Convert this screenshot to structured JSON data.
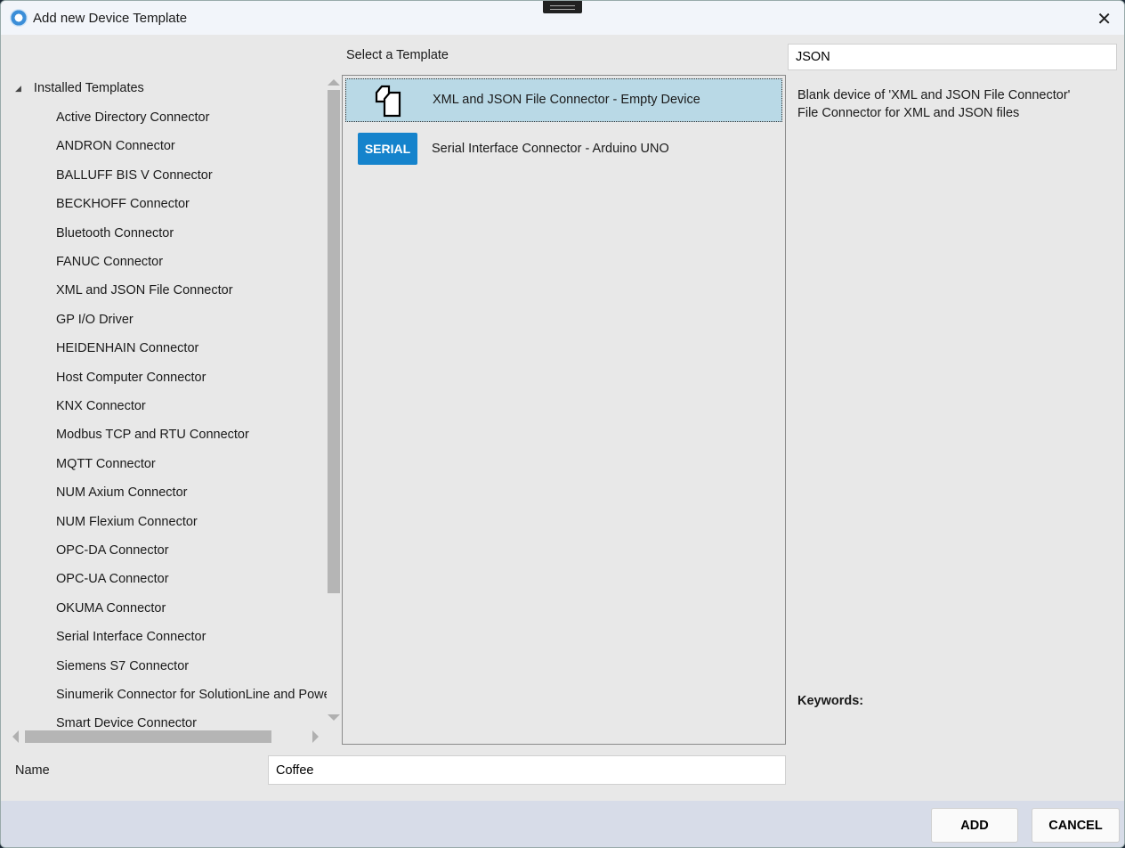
{
  "window": {
    "title": "Add new Device Template"
  },
  "tree": {
    "root_label": "Installed Templates",
    "items": [
      "Active Directory Connector",
      "ANDRON Connector",
      "BALLUFF BIS V Connector",
      "BECKHOFF Connector",
      "Bluetooth Connector",
      "FANUC Connector",
      "XML and JSON File Connector",
      "GP I/O Driver",
      "HEIDENHAIN Connector",
      "Host Computer Connector",
      "KNX Connector",
      "Modbus TCP and RTU Connector",
      "MQTT Connector",
      "NUM Axium Connector",
      "NUM Flexium Connector",
      "OPC-DA Connector",
      "OPC-UA Connector",
      "OKUMA Connector",
      "Serial Interface Connector",
      "Siemens S7 Connector",
      "Sinumerik Connector for SolutionLine and PowerLine",
      "Smart Device Connector"
    ]
  },
  "templates": {
    "heading": "Select a Template",
    "items": [
      {
        "label": "XML and JSON File Connector - Empty Device",
        "icon": "files-icon",
        "selected": true
      },
      {
        "label": "Serial Interface Connector - Arduino UNO",
        "icon": "serial-badge",
        "badge": "SERIAL"
      }
    ]
  },
  "search": {
    "value": "JSON"
  },
  "description": {
    "line1": "Blank device of 'XML and JSON File Connector'",
    "line2": "File Connector for XML and JSON files",
    "keywords_label": "Keywords:"
  },
  "name": {
    "label": "Name",
    "value": "Coffee"
  },
  "buttons": {
    "add": "ADD",
    "cancel": "CANCEL"
  },
  "colors": {
    "selection": "#b9d9e6",
    "serial_badge": "#1583cc",
    "footer": "#d7dce8"
  }
}
